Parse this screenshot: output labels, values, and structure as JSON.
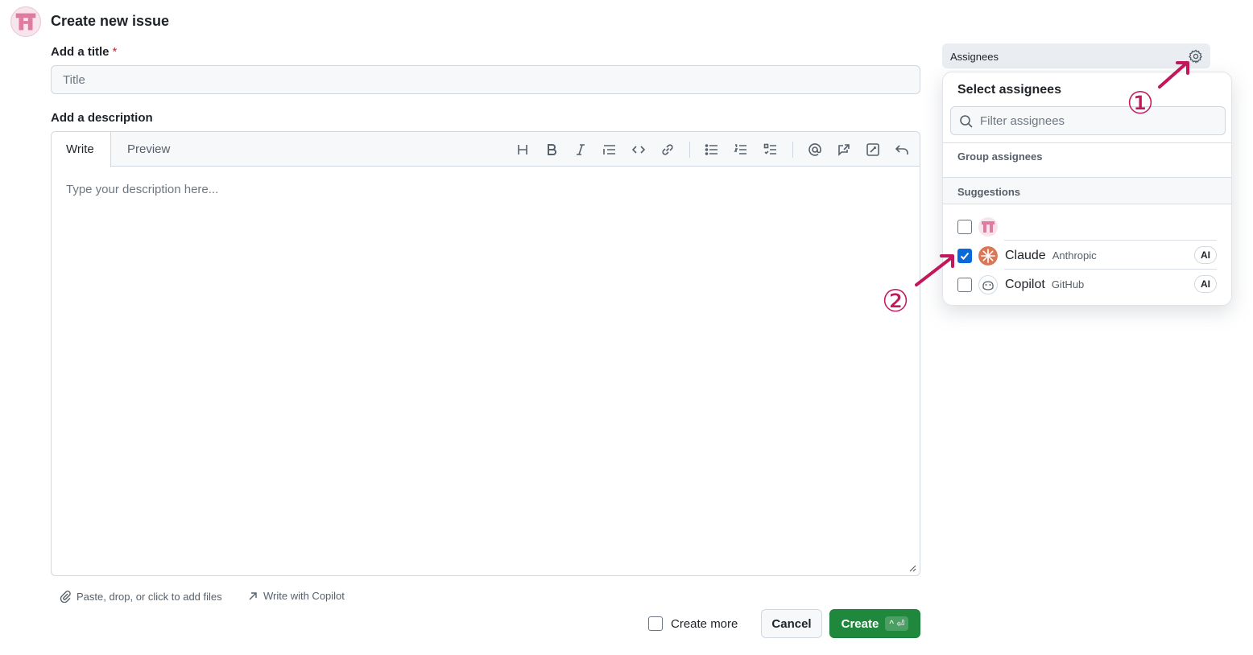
{
  "page": {
    "title": "Create new issue"
  },
  "form": {
    "title_label": "Add a title",
    "required_mark": "*",
    "title_placeholder": "Title",
    "description_label": "Add a description",
    "tabs": [
      {
        "label": "Write",
        "active": true
      },
      {
        "label": "Preview",
        "active": false
      }
    ],
    "toolbar": [
      "heading-icon",
      "bold-icon",
      "italic-icon",
      "quote-icon",
      "code-icon",
      "link-icon",
      "bulleted-list-icon",
      "numbered-list-icon",
      "task-list-icon",
      "mention-icon",
      "reference-icon",
      "saved-replies-icon",
      "undo-icon"
    ],
    "description_placeholder": "Type your description here...",
    "attach_text": "Paste, drop, or click to add files",
    "copilot_text": "Write with Copilot",
    "create_more_label": "Create more",
    "cancel_label": "Cancel",
    "create_label": "Create",
    "create_shortcut": "^ ⏎"
  },
  "sidebar": {
    "assignees_label": "Assignees",
    "dropdown": {
      "title": "Select assignees",
      "filter_placeholder": "Filter assignees",
      "group_label": "Group assignees",
      "suggestions_label": "Suggestions",
      "items": [
        {
          "name": "",
          "sub": "",
          "checked": false,
          "badge": ""
        },
        {
          "name": "Claude",
          "sub": "Anthropic",
          "checked": true,
          "badge": "AI"
        },
        {
          "name": "Copilot",
          "sub": "GitHub",
          "checked": false,
          "badge": "AI"
        }
      ]
    }
  },
  "annotations": {
    "step1": "①",
    "step2": "②"
  },
  "colors": {
    "accent_green": "#1f883d",
    "checkbox_blue": "#0969da",
    "annotation": "#c2185b",
    "claude_orange": "#d97757"
  }
}
